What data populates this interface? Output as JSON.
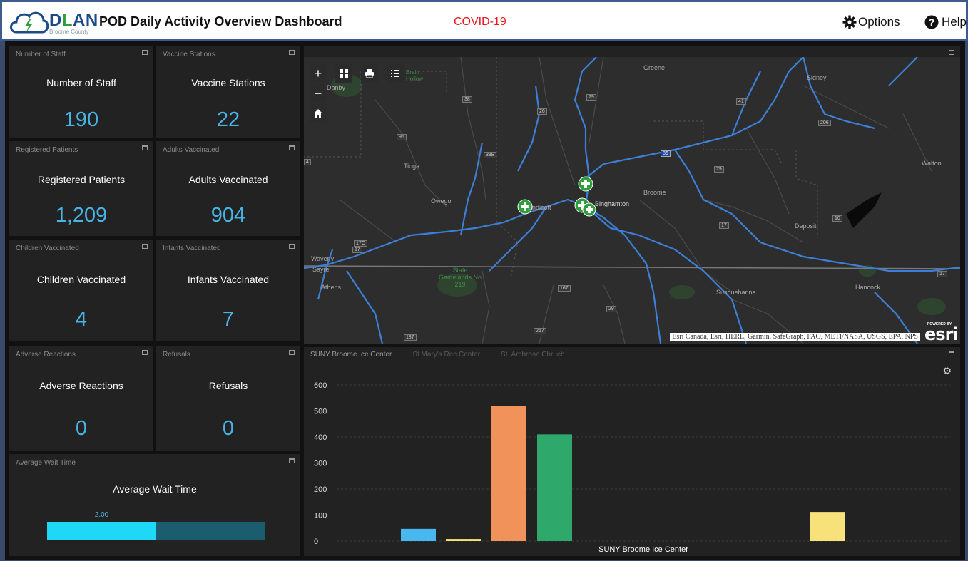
{
  "header": {
    "logo_text_d": "D",
    "logo_text_l": "L",
    "logo_text_an": "AN",
    "logo_subtitle": "Broome County",
    "title": "POD Daily Activity Overview Dashboard",
    "alert": "COVID-19",
    "options_label": "Options",
    "help_label": "Help"
  },
  "indicators": [
    {
      "header": "Number of Staff",
      "label": "Number of Staff",
      "value": "190"
    },
    {
      "header": "Vaccine Stations",
      "label": "Vaccine Stations",
      "value": "22"
    },
    {
      "header": "Registered Patients",
      "label": "Registered Patients",
      "value": "1,209"
    },
    {
      "header": "Adults Vaccinated",
      "label": "Adults Vaccinated",
      "value": "904"
    },
    {
      "header": "Children Vaccinated",
      "label": "Children Vaccinated",
      "value": "4"
    },
    {
      "header": "Infants Vaccinated",
      "label": "Infants Vaccinated",
      "value": "7"
    },
    {
      "header": "Adverse Reactions",
      "label": "Adverse Reactions",
      "value": "0"
    },
    {
      "header": "Refusals",
      "label": "Refusals",
      "value": "0"
    }
  ],
  "wait_time": {
    "header": "Average Wait Time",
    "label": "Average Wait Time",
    "value_label": "2.00",
    "fill_fraction": 0.5,
    "fill_color": "#1ed8f5",
    "track_color": "#1b5c6e"
  },
  "map": {
    "attribution": "Esri Canada, Esri, HERE, Garmin, SafeGraph, FAO, METI/NASA, USGS, EPA, NPS",
    "esri_powered": "POWERED BY",
    "esri_name": "esri",
    "place_labels": [
      "Greene",
      "Sidney",
      "Danby",
      "Tioga",
      "Owego",
      "Endicott",
      "Binghamton",
      "Broome",
      "Walton",
      "Deposit",
      "Waverly",
      "Sayre",
      "Athens",
      "State Gamelands No 219",
      "Susquehanna",
      "Hancock",
      "Brain Hollow"
    ],
    "route_shields": [
      "38",
      "26",
      "79",
      "41",
      "206",
      "96",
      "38B",
      "86",
      "79",
      "4",
      "17C",
      "17",
      "167",
      "29",
      "267",
      "187",
      "17",
      "10",
      "17"
    ]
  },
  "chart": {
    "tabs": [
      "SUNY Broome Ice Center",
      "St Mary's Rec Center",
      "St. Ambrose Chruch"
    ],
    "active_tab": 0,
    "chart_data": {
      "type": "bar",
      "categories": [
        "SUNY Broome Ice Center"
      ],
      "xlabel": "SUNY Broome Ice Center",
      "ylim": [
        0,
        600
      ],
      "yticks": [
        0,
        100,
        200,
        300,
        400,
        500,
        600
      ],
      "grid": true,
      "series": [
        {
          "value": 47,
          "color": "#4ab8f0"
        },
        {
          "value": 8,
          "color": "#f7e17a"
        },
        {
          "value": 518,
          "color": "#f1925a"
        },
        {
          "value": 410,
          "color": "#2fa86c"
        },
        {
          "value": 112,
          "color": "#f7e17a"
        }
      ]
    }
  }
}
